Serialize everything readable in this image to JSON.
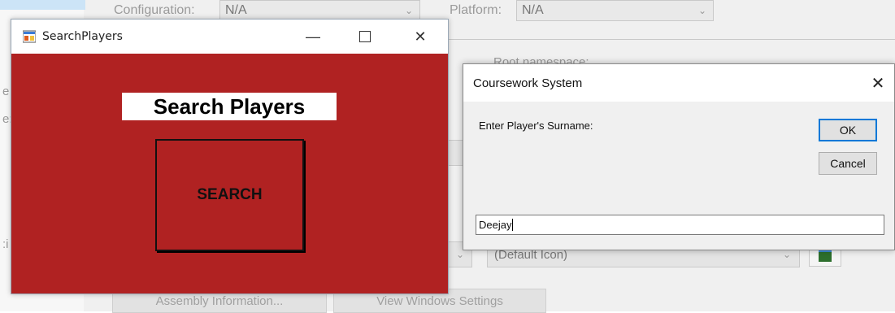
{
  "background": {
    "configuration_label": "Configuration:",
    "configuration_value": "N/A",
    "platform_label": "Platform:",
    "platform_value": "N/A",
    "root_namespace_label": "Root namespace:",
    "icon_value": "(Default Icon)",
    "assembly_button": "Assembly Information...",
    "view_windows_button": "View Windows Settings"
  },
  "search_window": {
    "title": "SearchPlayers",
    "heading": "Search Players",
    "search_button": "SEARCH",
    "background_color": "#b02222"
  },
  "dialog": {
    "title": "Coursework System",
    "prompt": "Enter Player's Surname:",
    "ok_label": "OK",
    "cancel_label": "Cancel",
    "input_value": "Deejay"
  }
}
